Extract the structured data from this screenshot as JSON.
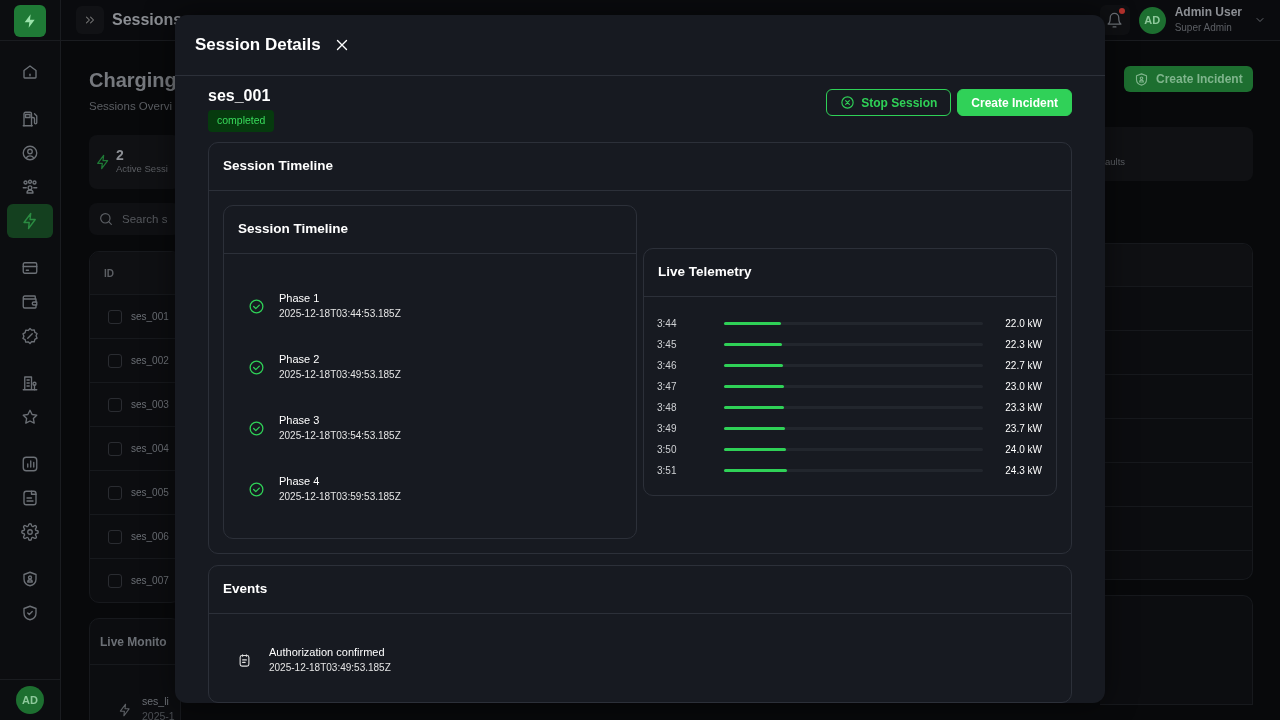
{
  "sidebar": {
    "groups": [
      [
        {
          "selected": false
        }
      ],
      [
        {
          "selected": false
        },
        {
          "selected": false
        },
        {
          "selected": false
        },
        {
          "selected": true
        }
      ],
      [
        {
          "selected": false
        },
        {
          "selected": false
        },
        {
          "selected": false
        }
      ],
      [
        {
          "selected": false
        },
        {
          "selected": false
        }
      ],
      [
        {
          "selected": false
        },
        {
          "selected": false
        },
        {
          "selected": false
        }
      ],
      [
        {
          "selected": false
        },
        {
          "selected": false
        }
      ]
    ],
    "avatar": "AD"
  },
  "topbar": {
    "title": "Sessions",
    "notifications": true,
    "user": {
      "initials": "AD",
      "name": "Admin User",
      "role": "Super Admin"
    }
  },
  "page": {
    "title": "Charging",
    "subtitle": "Sessions Overvi",
    "stats": [
      {
        "value": "2",
        "label": "Active Sessi"
      },
      {
        "label": "aults"
      }
    ],
    "create_button": "Create Incident",
    "search": {
      "placeholder": "Search s"
    },
    "table": {
      "columns": [
        "ID"
      ],
      "rows": [
        {
          "id": "ses_001",
          "checked": false
        },
        {
          "id": "ses_002",
          "checked": false
        },
        {
          "id": "ses_003",
          "checked": false
        },
        {
          "id": "ses_004",
          "checked": false
        },
        {
          "id": "ses_005",
          "checked": false
        },
        {
          "id": "ses_006",
          "checked": false
        },
        {
          "id": "ses_007",
          "checked": false
        }
      ]
    },
    "live_monitor": {
      "title": "Live Monito",
      "rows": [
        {
          "id": "ses_li",
          "time": "2025-1"
        }
      ]
    }
  },
  "modal": {
    "title": "Session Details",
    "session_id": "ses_001",
    "status": {
      "label": "completed",
      "kind": "success"
    },
    "actions": [
      {
        "label": "Stop Session",
        "kind": "outline"
      },
      {
        "label": "Create Incident",
        "kind": "primary"
      }
    ],
    "timeline_section": {
      "title": "Session Timeline",
      "timeline": {
        "title": "Session Timeline",
        "phases": [
          {
            "name": "Phase 1",
            "time": "2025-12-18T03:44:53.185Z",
            "done": true
          },
          {
            "name": "Phase 2",
            "time": "2025-12-18T03:49:53.185Z",
            "done": true
          },
          {
            "name": "Phase 3",
            "time": "2025-12-18T03:54:53.185Z",
            "done": true
          },
          {
            "name": "Phase 4",
            "time": "2025-12-18T03:59:53.185Z",
            "done": true
          }
        ]
      },
      "telemetry": {
        "title": "Live Telemetry",
        "rows": [
          {
            "time": "3:44",
            "level": 0.22,
            "reading": "22.0 kW"
          },
          {
            "time": "3:45",
            "level": 0.223,
            "reading": "22.3 kW"
          },
          {
            "time": "3:46",
            "level": 0.227,
            "reading": "22.7 kW"
          },
          {
            "time": "3:47",
            "level": 0.23,
            "reading": "23.0 kW"
          },
          {
            "time": "3:48",
            "level": 0.233,
            "reading": "23.3 kW"
          },
          {
            "time": "3:49",
            "level": 0.237,
            "reading": "23.7 kW"
          },
          {
            "time": "3:50",
            "level": 0.24,
            "reading": "24.0 kW"
          },
          {
            "time": "3:51",
            "level": 0.243,
            "reading": "24.3 kW"
          }
        ]
      }
    },
    "events": {
      "title": "Events",
      "items": [
        {
          "title": "Authorization confirmed",
          "time": "2025-12-18T03:49:53.185Z"
        }
      ]
    }
  }
}
